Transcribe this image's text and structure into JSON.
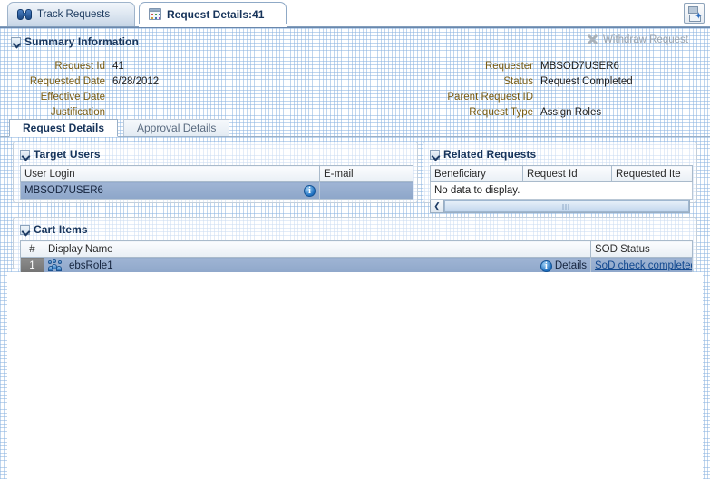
{
  "window": {
    "save_icon": "save-icon"
  },
  "tabs": [
    {
      "label": "Track Requests",
      "icon": "binoculars-icon",
      "active": false
    },
    {
      "label": "Request Details:41",
      "icon": "report-icon",
      "active": true
    }
  ],
  "summary": {
    "title": "Summary Information",
    "withdraw_label": "Withdraw Request",
    "withdraw_icon": "cancel-x-icon",
    "left_fields": [
      {
        "label": "Request Id",
        "value": "41"
      },
      {
        "label": "Requested Date",
        "value": "6/28/2012"
      },
      {
        "label": "Effective Date",
        "value": ""
      },
      {
        "label": "Justification",
        "value": ""
      }
    ],
    "right_fields": [
      {
        "label": "Requester",
        "value": "MBSOD7USER6"
      },
      {
        "label": "Status",
        "value": "Request Completed"
      },
      {
        "label": "Parent Request ID",
        "value": ""
      },
      {
        "label": "Request Type",
        "value": "Assign Roles"
      }
    ]
  },
  "subtabs": [
    {
      "label": "Request Details",
      "active": true
    },
    {
      "label": "Approval Details",
      "active": false
    }
  ],
  "target_users": {
    "title": "Target Users",
    "columns": [
      "User Login",
      "E-mail"
    ],
    "rows": [
      {
        "user_login": "MBSOD7USER6",
        "email": "",
        "selected": true,
        "info_icon": "info-icon"
      }
    ]
  },
  "related_requests": {
    "title": "Related Requests",
    "columns": [
      "Beneficiary",
      "Request Id",
      "Requested Ite"
    ],
    "empty_text": "No data to display.",
    "scroll": {
      "left_arrow": "❮"
    }
  },
  "cart_items": {
    "title": "Cart Items",
    "columns": [
      "#",
      "Display Name",
      "SOD Status"
    ],
    "rows": [
      {
        "index": "1",
        "display_name": "ebsRole1",
        "role_icon": "role-group-icon",
        "details_label": "Details",
        "details_icon": "info-icon",
        "sod_status": "SoD check completed",
        "selected": true
      }
    ]
  },
  "colors": {
    "accent": "#16335a",
    "label": "#7a5c12",
    "link": "#12488f",
    "selection": "#8da6c9",
    "disabled": "#9aa3ad"
  }
}
